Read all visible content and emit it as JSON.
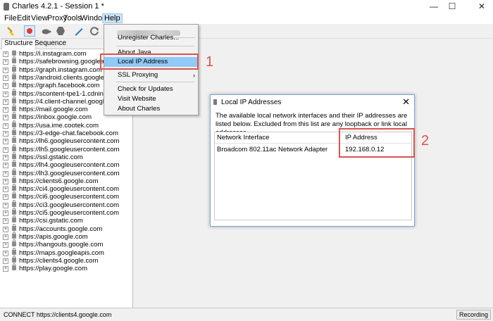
{
  "window": {
    "title": "Charles 4.2.1 - Session 1 *",
    "controls": [
      "—",
      "☐",
      "✕"
    ]
  },
  "menu": [
    "File",
    "Edit",
    "View",
    "Proxy",
    "Tools",
    "Window",
    "Help"
  ],
  "tabs": [
    "Structure",
    "Sequence"
  ],
  "hosts": [
    "https://i.instagram.com",
    "https://safebrowsing.googleapis.c",
    "https://graph.instagram.com",
    "https://android.clients.google.com",
    "https://graph.facebook.com",
    "https://scontent-tpe1-1.cdninstag",
    "https://4.client-channel.google.co",
    "https://mail.google.com",
    "https://inbox.google.com",
    "https://usa.ime.cootek.com",
    "https://3-edge-chat.facebook.com",
    "https://lh6.googleusercontent.com",
    "https://lh5.googleusercontent.com",
    "https://ssl.gstatic.com",
    "https://lh4.googleusercontent.com",
    "https://lh3.googleusercontent.com",
    "https://clients6.google.com",
    "https://ci4.googleusercontent.com",
    "https://ci6.googleusercontent.com",
    "https://ci3.googleusercontent.com",
    "https://ci5.googleusercontent.com",
    "https://csi.gstatic.com",
    "https://accounts.google.com",
    "https://apis.google.com",
    "https://hangouts.google.com",
    "https://maps.googleapis.com",
    "https://clients4.google.com",
    "https://play.google.com"
  ],
  "help_menu": {
    "items": [
      {
        "label": "Unregister Charles..."
      },
      {
        "label": "About Java"
      },
      {
        "label": "Local IP Address"
      },
      {
        "label": "SSL Proxying",
        "submenu_arrow": "›"
      },
      {
        "label": "Check for Updates"
      },
      {
        "label": "Visit Website"
      },
      {
        "label": "About Charles"
      }
    ]
  },
  "annotations": {
    "one": "1",
    "two": "2"
  },
  "dialog": {
    "title": "Local IP Addresses",
    "close": "✕",
    "description": "The available local network interfaces and their IP addresses are listed below.  Excluded from this list are any loopback or link local addresses.",
    "columns": [
      "Network Interface",
      "IP Address"
    ],
    "rows": [
      {
        "interface": "Broadcom 802.11ac Network Adapter",
        "ip": "192.168.0.12"
      }
    ]
  },
  "status": {
    "text": "CONNECT https://clients4.google.com",
    "recording": "Recording"
  },
  "colors": {
    "highlight": "#91c9f7",
    "annotation": "#d9534f",
    "record": "#e53935"
  }
}
